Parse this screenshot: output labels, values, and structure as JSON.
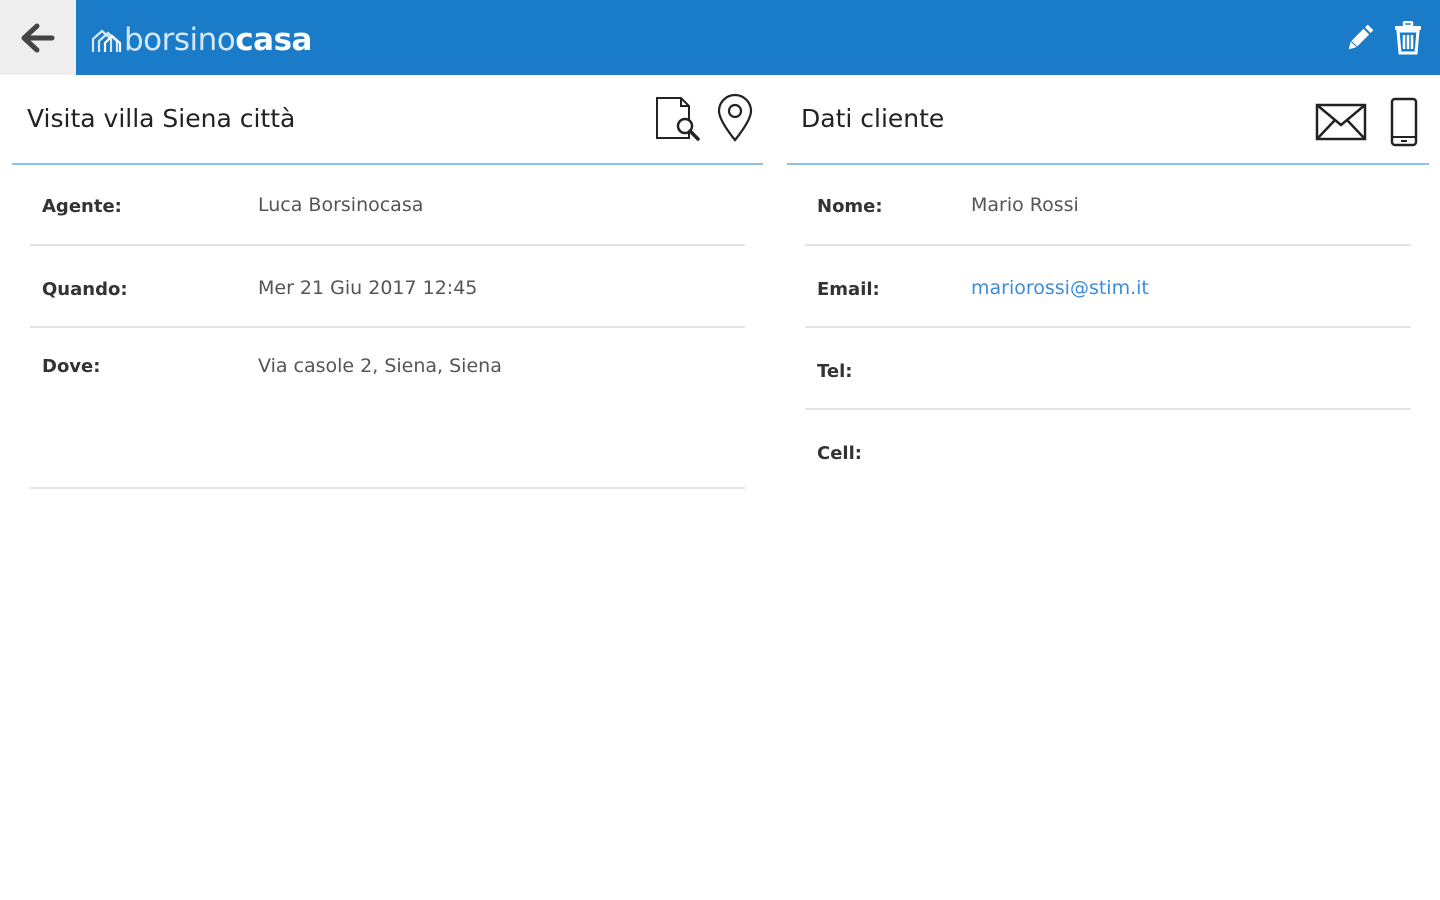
{
  "app": {
    "logo_part1": "borsino",
    "logo_part2": "casa"
  },
  "visit": {
    "title": "Visita villa Siena città",
    "rows": [
      {
        "label": "Agente:",
        "value": "Luca Borsinocasa"
      },
      {
        "label": "Quando:",
        "value": "Mer 21 Giu 2017 12:45"
      },
      {
        "label": "Dove:",
        "value": "Via casole 2, Siena, Siena"
      }
    ]
  },
  "client": {
    "title": "Dati cliente",
    "rows": [
      {
        "label": "Nome:",
        "value": "Mario Rossi"
      },
      {
        "label": "Email:",
        "value": "mariorossi@stim.it"
      },
      {
        "label": "Tel:",
        "value": ""
      },
      {
        "label": "Cell:",
        "value": ""
      }
    ]
  },
  "colors": {
    "topbar": "#1a7bc9",
    "accent_line": "#8fc0ec",
    "link": "#3a8ddb"
  },
  "icons": {
    "back": "arrow-left-icon",
    "edit": "pencil-icon",
    "delete": "trash-icon",
    "document_search": "document-search-icon",
    "location": "map-pin-icon",
    "mail": "envelope-icon",
    "phone": "smartphone-icon"
  }
}
